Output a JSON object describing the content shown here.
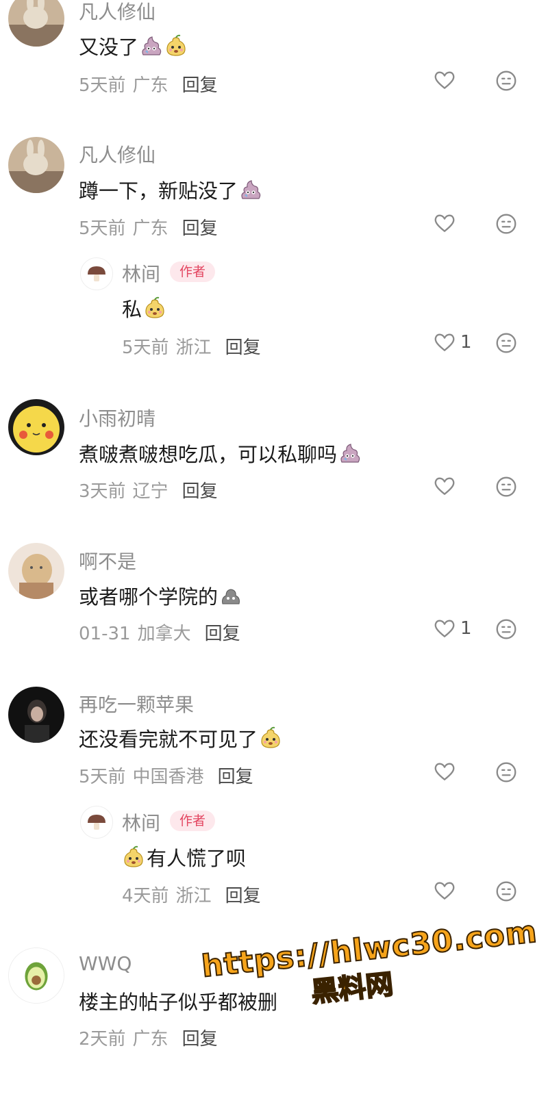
{
  "comments": [
    {
      "user": "凡人修仙",
      "text": "又没了",
      "time": "5天前",
      "location": "广东",
      "reply": "回复",
      "likes": ""
    },
    {
      "user": "凡人修仙",
      "text": "蹲一下，新贴没了",
      "time": "5天前",
      "location": "广东",
      "reply": "回复",
      "likes": ""
    },
    {
      "user": "林间",
      "badge": "作者",
      "text": "私",
      "time": "5天前",
      "location": "浙江",
      "reply": "回复",
      "likes": "1"
    },
    {
      "user": "小雨初晴",
      "text": "煮啵煮啵想吃瓜，可以私聊吗",
      "time": "3天前",
      "location": "辽宁",
      "reply": "回复",
      "likes": ""
    },
    {
      "user": "啊不是",
      "text": "或者哪个学院的",
      "time": "01-31",
      "location": "加拿大",
      "reply": "回复",
      "likes": "1"
    },
    {
      "user": "再吃一颗苹果",
      "text": "还没看完就不可见了",
      "time": "5天前",
      "location": "中国香港",
      "reply": "回复",
      "likes": ""
    },
    {
      "user": "林间",
      "badge": "作者",
      "text": "有人慌了呗",
      "time": "4天前",
      "location": "浙江",
      "reply": "回复",
      "likes": ""
    },
    {
      "user": "WWQ",
      "text": "楼主的帖子似乎都被删",
      "time": "2天前",
      "location": "广东",
      "reply": "回复",
      "likes": ""
    }
  ],
  "watermark": {
    "url": "https://hlwc30.com",
    "name": "黑料网"
  },
  "colors": {
    "accent": "#e34560",
    "muted": "#9a9a9a",
    "watermark": "#f6a41b"
  },
  "icons": [
    "heart-icon",
    "emoji-face-icon",
    "poop-emoji",
    "pear-face-emoji",
    "pikachu-avatar",
    "avocado-avatar",
    "mushroom-avatar"
  ]
}
